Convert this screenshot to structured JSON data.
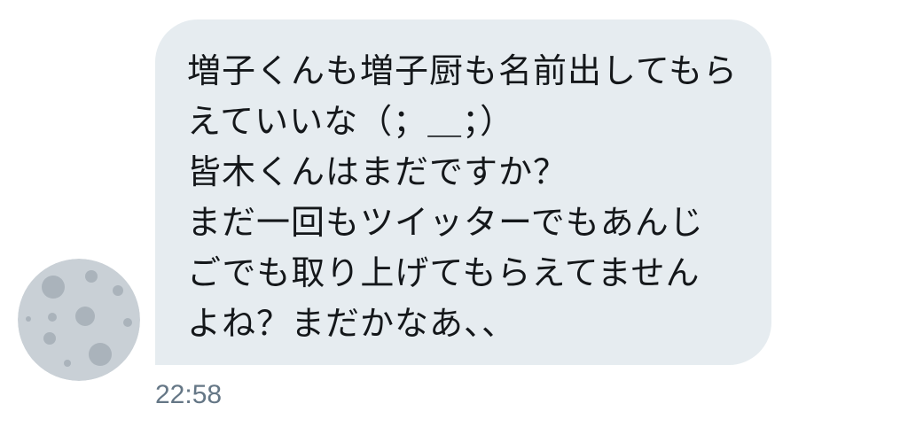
{
  "message": {
    "lines": [
      "増子くんも増子厨も名前出してもら",
      "えていいな（；＿；）",
      "皆木くんはまだですか？",
      "まだ一回もツイッターでもあんじ",
      "ごでも取り上げてもらえてません",
      "よね？まだかなあ、、"
    ],
    "timestamp": "22:58"
  },
  "avatar": {
    "icon": "moon-icon",
    "colors": {
      "face": "#c9d0d6",
      "crater": "#a9b2ba"
    }
  },
  "colors": {
    "bubble_bg": "#e6ecf0",
    "text": "#14171a",
    "timestamp": "#657786"
  }
}
